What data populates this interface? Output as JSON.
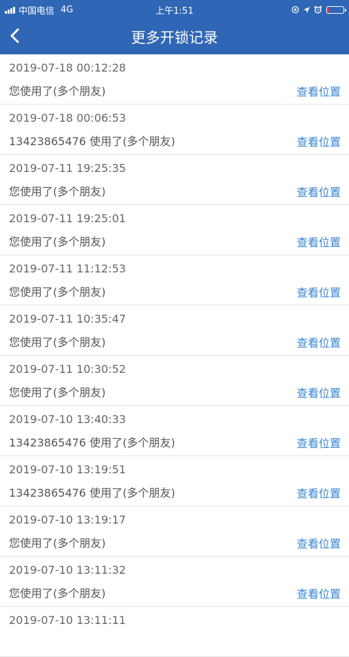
{
  "status_bar": {
    "carrier": "中国电信",
    "network": "4G",
    "time": "上午1:51",
    "icons": [
      "orientation-lock-icon",
      "location-arrow-icon",
      "alarm-icon",
      "battery-icon"
    ],
    "battery_level": 0.1,
    "battery_color": "#e8343b"
  },
  "nav": {
    "back_icon": "chevron-left-icon",
    "title": "更多开锁记录"
  },
  "colors": {
    "header_bg": "#2f66b5",
    "link": "#3a86d0"
  },
  "records": [
    {
      "time": "2019-07-18 00:12:28",
      "desc": "您使用了(多个朋友)",
      "action": "查看位置"
    },
    {
      "time": "2019-07-18 00:06:53",
      "desc": "13423865476 使用了(多个朋友)",
      "action": "查看位置"
    },
    {
      "time": "2019-07-11 19:25:35",
      "desc": "您使用了(多个朋友)",
      "action": "查看位置"
    },
    {
      "time": "2019-07-11 19:25:01",
      "desc": "您使用了(多个朋友)",
      "action": "查看位置"
    },
    {
      "time": "2019-07-11 11:12:53",
      "desc": "您使用了(多个朋友)",
      "action": "查看位置"
    },
    {
      "time": "2019-07-11 10:35:47",
      "desc": "您使用了(多个朋友)",
      "action": "查看位置"
    },
    {
      "time": "2019-07-11 10:30:52",
      "desc": "您使用了(多个朋友)",
      "action": "查看位置"
    },
    {
      "time": "2019-07-10 13:40:33",
      "desc": "13423865476 使用了(多个朋友)",
      "action": "查看位置"
    },
    {
      "time": "2019-07-10 13:19:51",
      "desc": "13423865476 使用了(多个朋友)",
      "action": "查看位置"
    },
    {
      "time": "2019-07-10 13:19:17",
      "desc": "您使用了(多个朋友)",
      "action": "查看位置"
    },
    {
      "time": "2019-07-10 13:11:32",
      "desc": "您使用了(多个朋友)",
      "action": "查看位置"
    },
    {
      "time": "2019-07-10 13:11:11",
      "desc": "",
      "action": ""
    }
  ]
}
